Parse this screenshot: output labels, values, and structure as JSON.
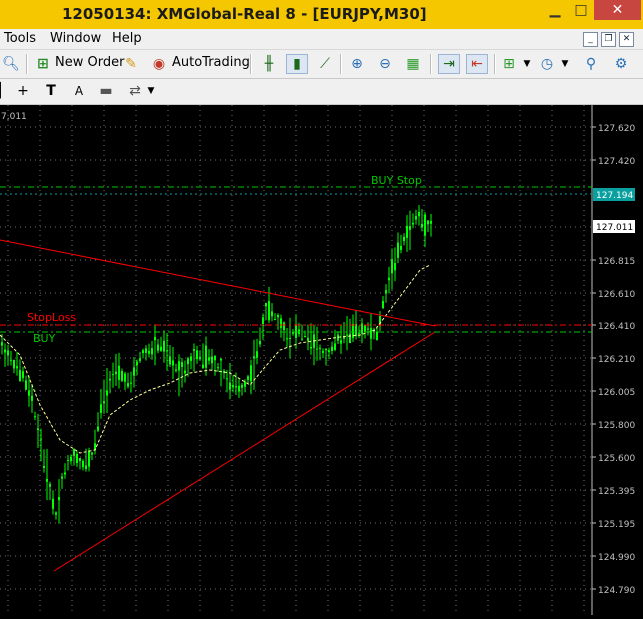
{
  "window": {
    "title": "12050134: XMGlobal-Real 8 - [EURJPY,M30]"
  },
  "menu": [
    "Tools",
    "Window",
    "Help"
  ],
  "toolbar": {
    "new_order_label": "New Order",
    "autotrading_label": "AutoTrading"
  },
  "chart": {
    "corner_label": "7,011",
    "price_scale": [
      "127.620",
      "127.420",
      "127.194",
      "127.011",
      "126.815",
      "126.610",
      "126.410",
      "126.210",
      "126.005",
      "125.800",
      "125.600",
      "125.395",
      "125.195",
      "124.990",
      "124.790"
    ],
    "current_price": "127.011",
    "buy_stop_price": "127.194",
    "orders": {
      "buy_stop_label": "BUY Stop",
      "stoploss_label": "StopLoss",
      "buy_label": "BUY"
    },
    "colors": {
      "background": "#000000",
      "candles": "#00ff00",
      "trendlines": "#ff0000",
      "moving_average": "#ffff99",
      "buy_lines": "#00c800",
      "stoploss_line": "#ff0000",
      "buy_stop_box": "#0aa0a0"
    }
  }
}
